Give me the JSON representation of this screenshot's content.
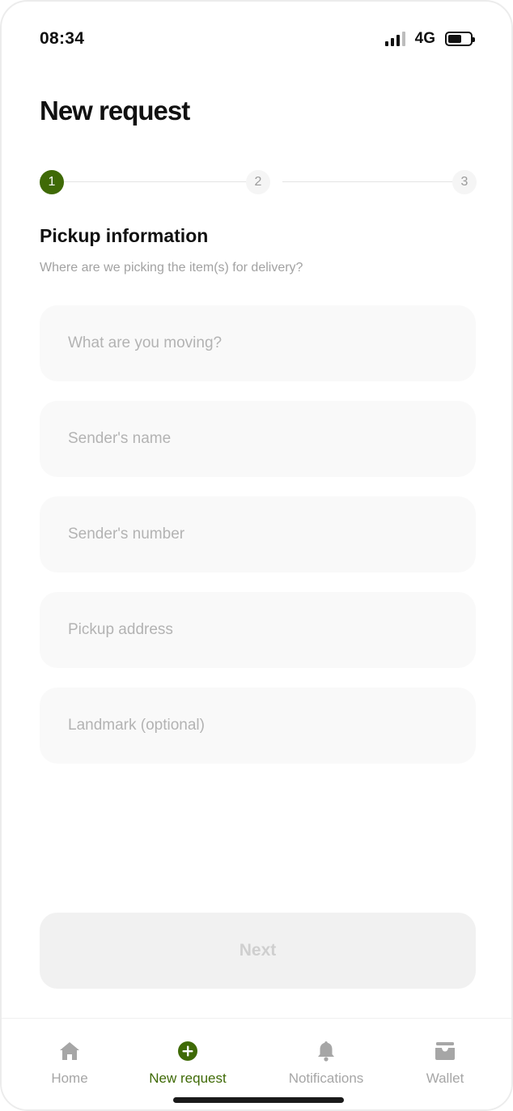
{
  "status_bar": {
    "time": "08:34",
    "network": "4G"
  },
  "header": {
    "title": "New request"
  },
  "stepper": {
    "steps": [
      "1",
      "2",
      "3"
    ],
    "active_step": 1
  },
  "section": {
    "title": "Pickup information",
    "subtitle": "Where are we picking the item(s) for delivery?"
  },
  "form": {
    "fields": [
      {
        "placeholder": "What are you moving?",
        "value": ""
      },
      {
        "placeholder": "Sender's name",
        "value": ""
      },
      {
        "placeholder": "Sender's number",
        "value": ""
      },
      {
        "placeholder": "Pickup address",
        "value": ""
      },
      {
        "placeholder": "Landmark (optional)",
        "value": ""
      }
    ],
    "next_label": "Next"
  },
  "bottom_nav": {
    "items": [
      {
        "label": "Home",
        "icon": "home-icon",
        "active": false
      },
      {
        "label": "New request",
        "icon": "plus-circle-icon",
        "active": true
      },
      {
        "label": "Notifications",
        "icon": "bell-icon",
        "active": false
      },
      {
        "label": "Wallet",
        "icon": "wallet-icon",
        "active": false
      }
    ]
  },
  "colors": {
    "accent": "#3f6a06",
    "inactive": "#a6a6a6",
    "field_bg": "#f9f9f9",
    "disabled_button_bg": "#f1f1f1"
  }
}
